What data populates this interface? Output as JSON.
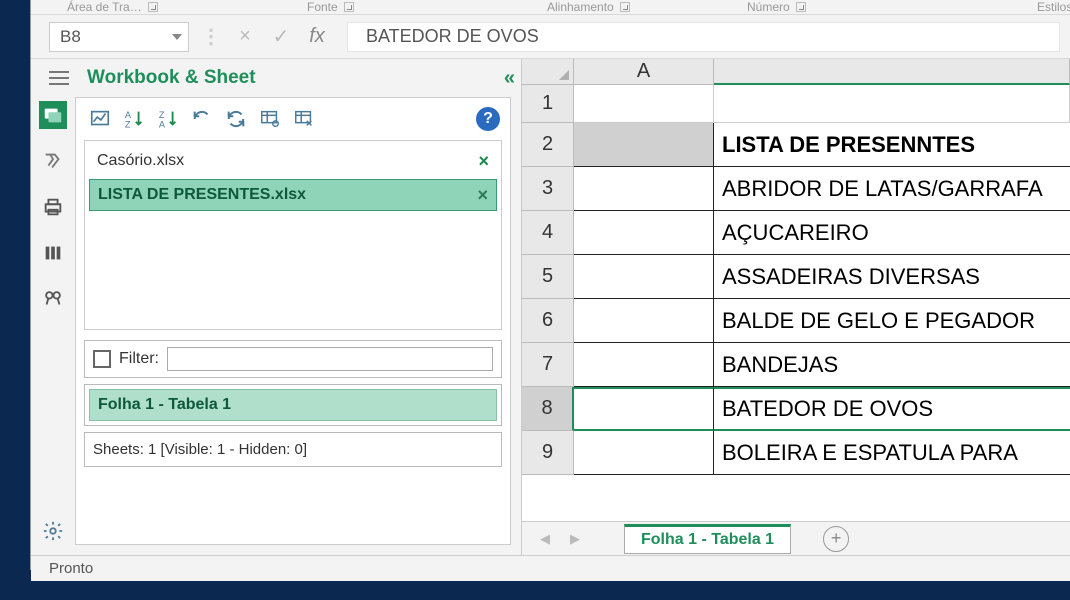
{
  "ribbon_groups": {
    "clipboard": "Área de Tra…",
    "font": "Fonte",
    "alignment": "Alinhamento",
    "number": "Número",
    "styles": "Estilos"
  },
  "formula_bar": {
    "cell_ref": "B8",
    "fx_label": "fx",
    "content": "BATEDOR DE OVOS"
  },
  "pane": {
    "title": "Workbook & Sheet",
    "help": "?",
    "files": [
      {
        "name": "Casório.xlsx",
        "active": false
      },
      {
        "name": "LISTA DE PRESENTES.xlsx",
        "active": true
      }
    ],
    "filter_label": "Filter:",
    "sheet_item": "Folha 1 - Tabela 1",
    "sheet_stats": "Sheets: 1  [Visible: 1 - Hidden: 0]"
  },
  "grid": {
    "col_header": "A",
    "rows": [
      {
        "num": "1",
        "a": ""
      },
      {
        "num": "2",
        "a": "LISTA DE PRESENNTES"
      },
      {
        "num": "3",
        "a": "ABRIDOR DE LATAS/GARRAFA"
      },
      {
        "num": "4",
        "a": "AÇUCAREIRO"
      },
      {
        "num": "5",
        "a": "ASSADEIRAS DIVERSAS"
      },
      {
        "num": "6",
        "a": "BALDE DE GELO E PEGADOR"
      },
      {
        "num": "7",
        "a": "BANDEJAS"
      },
      {
        "num": "8",
        "a": "BATEDOR DE OVOS"
      },
      {
        "num": "9",
        "a": "BOLEIRA  E ESPATULA PARA"
      }
    ],
    "selected_row": "8"
  },
  "tabs": {
    "active": "Folha 1 - Tabela 1"
  },
  "status": "Pronto"
}
